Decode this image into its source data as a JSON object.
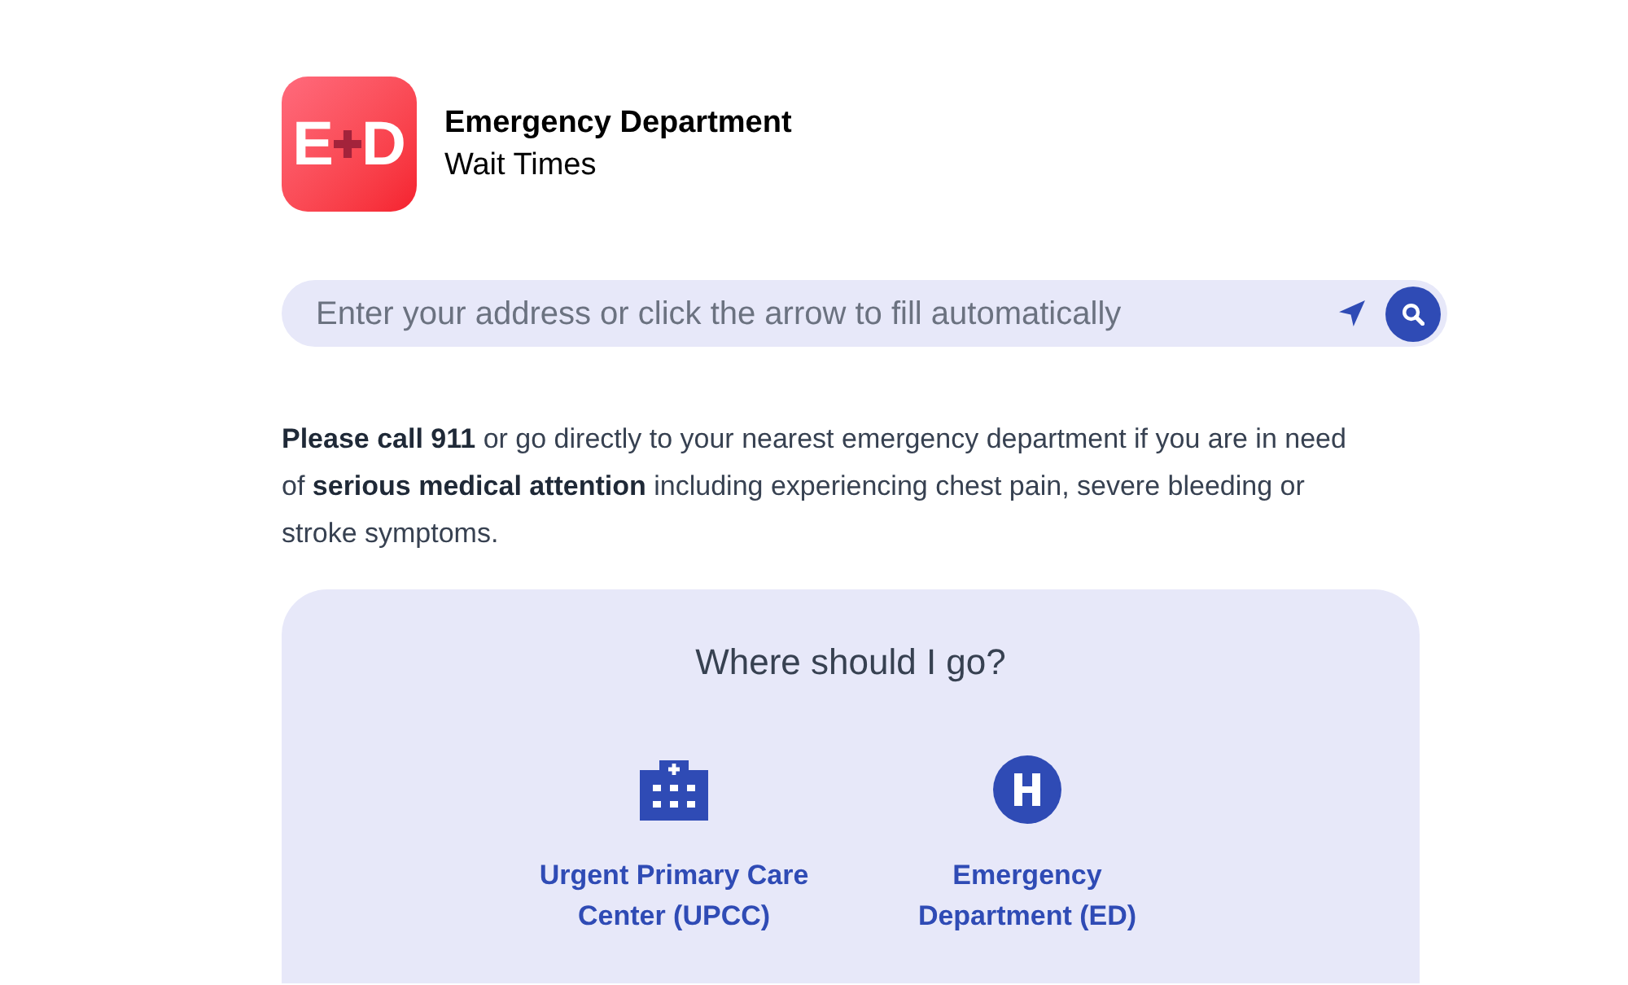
{
  "header": {
    "logo": {
      "letters": [
        "E",
        "D"
      ]
    },
    "title": "Emergency Department",
    "subtitle": "Wait Times"
  },
  "search": {
    "placeholder": "Enter your address or click the arrow to fill automatically"
  },
  "notice": "**Please call 911** or go directly to your nearest emergency department if you are in need of **serious medical attention** including experiencing chest pain, severe bleeding or stroke symptoms.",
  "guide": {
    "title": "Where should I go?",
    "options": [
      {
        "kind": "clinic",
        "name": "Urgent Primary Care Center (UPCC)"
      },
      {
        "kind": "hospital",
        "name": "Emergency Department (ED)"
      }
    ]
  }
}
